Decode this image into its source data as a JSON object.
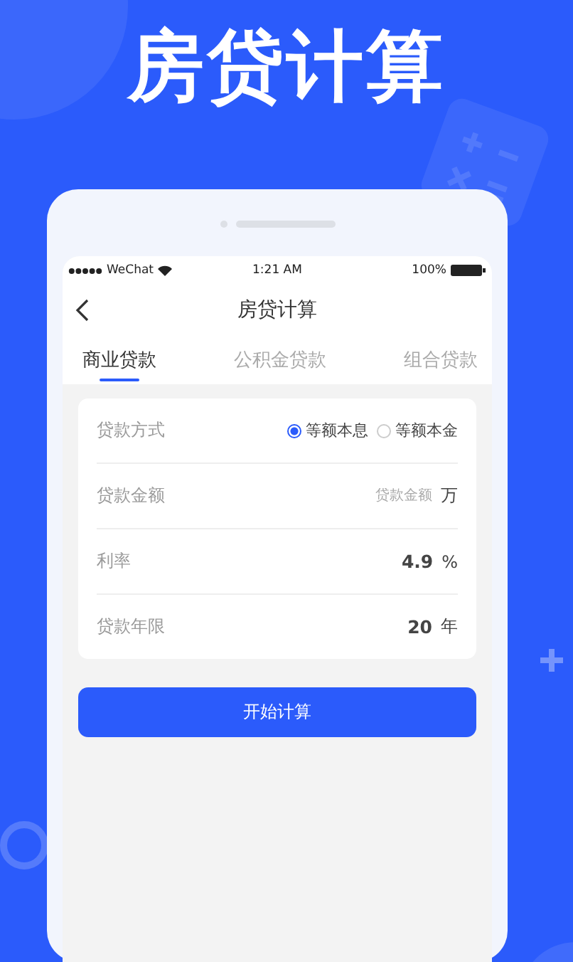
{
  "headline": "房贷计算",
  "status_bar": {
    "carrier": "WeChat",
    "time": "1:21 AM",
    "battery": "100%"
  },
  "nav": {
    "title": "房贷计算"
  },
  "tabs": [
    {
      "label": "商业贷款",
      "selected": true
    },
    {
      "label": "公积金贷款",
      "selected": false
    },
    {
      "label": "组合贷款",
      "selected": false
    }
  ],
  "form": {
    "rows": [
      {
        "kind": "radio",
        "label": "贷款方式",
        "options": [
          {
            "label": "等额本息",
            "selected": true
          },
          {
            "label": "等额本金",
            "selected": false
          }
        ]
      },
      {
        "kind": "input",
        "label": "贷款金额",
        "placeholder": "贷款金额",
        "unit": "万"
      },
      {
        "kind": "value",
        "label": "利率",
        "value": "4.9",
        "unit": "%"
      },
      {
        "kind": "value",
        "label": "贷款年限",
        "value": "20",
        "unit": "年"
      }
    ]
  },
  "button": "开始计算"
}
